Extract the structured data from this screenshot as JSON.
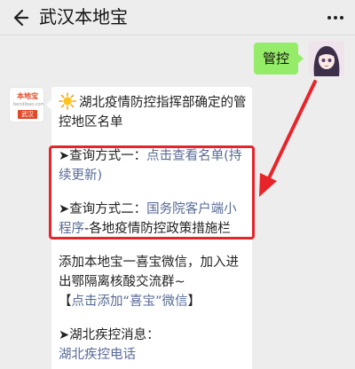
{
  "header": {
    "title": "武汉本地宝"
  },
  "sent_message": {
    "text": "管控"
  },
  "bot": {
    "logo_text": "本地宝",
    "logo_subtext": "bendibao.com",
    "logo_city": "武汉"
  },
  "reply": {
    "headline": "湖北疫情防控指挥部确定的管控地区名单",
    "query1_prefix": "➤查询方式一：",
    "query1_link": "点击查看名单(持续更新)",
    "query2_prefix": "➤查询方式二：",
    "query2_link": "国务院客户端小程序",
    "query2_suffix": "-各地疫情防控政策措施栏",
    "wechat_text": "添加本地宝一喜宝微信，加入进出鄂隔离核酸交流群~",
    "wechat_open": "【",
    "wechat_link": "点击添加“喜宝”微信",
    "wechat_close": "】",
    "news_prefix": "➤湖北疾控消息：",
    "news_link": "湖北疾控电话"
  },
  "colors": {
    "accent_link": "#576b95",
    "bubble_green": "#95ec69",
    "highlight_red": "#e8242b"
  }
}
